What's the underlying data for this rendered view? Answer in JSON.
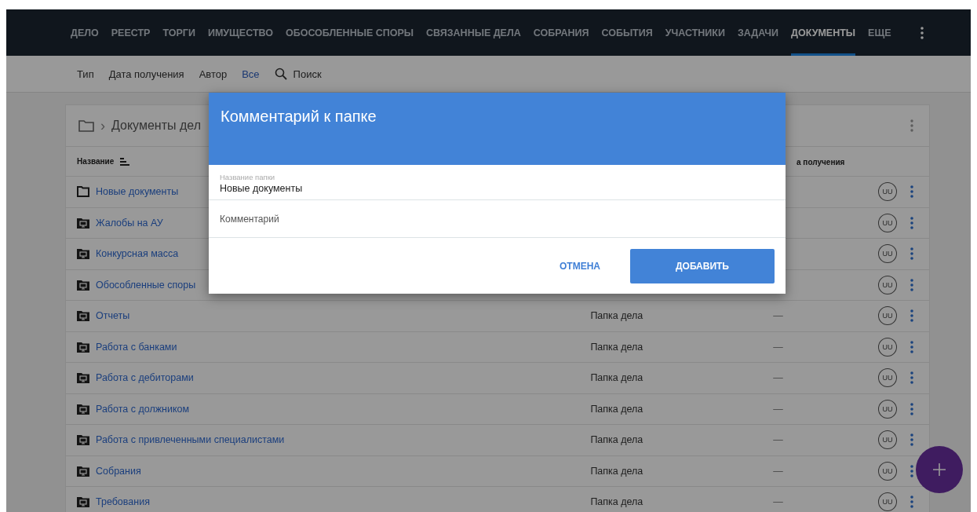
{
  "nav": {
    "tabs": [
      {
        "label": "ДЕЛО",
        "selected": false
      },
      {
        "label": "РЕЕСТР",
        "selected": false
      },
      {
        "label": "ТОРГИ",
        "selected": false
      },
      {
        "label": "ИМУЩЕСТВО",
        "selected": false
      },
      {
        "label": "ОБОСОБЛЕННЫЕ СПОРЫ",
        "selected": false
      },
      {
        "label": "СВЯЗАННЫЕ ДЕЛА",
        "selected": false
      },
      {
        "label": "СОБРАНИЯ",
        "selected": false
      },
      {
        "label": "СОБЫТИЯ",
        "selected": false
      },
      {
        "label": "УЧАСТНИКИ",
        "selected": false
      },
      {
        "label": "ЗАДАЧИ",
        "selected": false
      },
      {
        "label": "ДОКУМЕНТЫ",
        "selected": true
      },
      {
        "label": "ЕЩЕ",
        "selected": false
      }
    ]
  },
  "filters": {
    "items": [
      {
        "label": "Тип",
        "selected": false
      },
      {
        "label": "Дата получения",
        "selected": false
      },
      {
        "label": "Автор",
        "selected": false
      },
      {
        "label": "Все",
        "selected": true
      }
    ],
    "search_placeholder": "Поиск"
  },
  "card": {
    "breadcrumb_separator": "›",
    "breadcrumb": "Документы дел",
    "columns": {
      "name": "Название",
      "date": "а получения"
    },
    "rows": [
      {
        "kind": "folder",
        "name": "Новые документы",
        "author": "UU"
      },
      {
        "kind": "case-folder",
        "name": "Жалобы на АУ",
        "author": "UU"
      },
      {
        "kind": "case-folder",
        "name": "Конкурсная масса",
        "author": "UU"
      },
      {
        "kind": "case-folder",
        "name": "Обособленные споры",
        "author": "UU"
      },
      {
        "kind": "case-folder",
        "name": "Отчеты",
        "type": "Папка дела",
        "date": "—",
        "author": "UU"
      },
      {
        "kind": "case-folder",
        "name": "Работа с банками",
        "type": "Папка дела",
        "date": "—",
        "author": "UU"
      },
      {
        "kind": "case-folder",
        "name": "Работа с дебиторами",
        "type": "Папка дела",
        "date": "—",
        "author": "UU"
      },
      {
        "kind": "case-folder",
        "name": "Работа с должником",
        "type": "Папка дела",
        "date": "—",
        "author": "UU"
      },
      {
        "kind": "case-folder",
        "name": "Работа с привлеченными специалистами",
        "type": "Папка дела",
        "date": "—",
        "author": "UU"
      },
      {
        "kind": "case-folder",
        "name": "Собрания",
        "type": "Папка дела",
        "date": "—",
        "author": "UU"
      },
      {
        "kind": "case-folder",
        "name": "Требования",
        "type": "Папка дела",
        "date": "—",
        "author": "UU"
      }
    ]
  },
  "dialog": {
    "title": "Комментарий к папке",
    "name_label": "Название папки",
    "name_value": "Новые документы",
    "comment_placeholder": "Комментарий",
    "cancel": "ОТМЕНА",
    "submit": "ДОБАВИТЬ"
  }
}
